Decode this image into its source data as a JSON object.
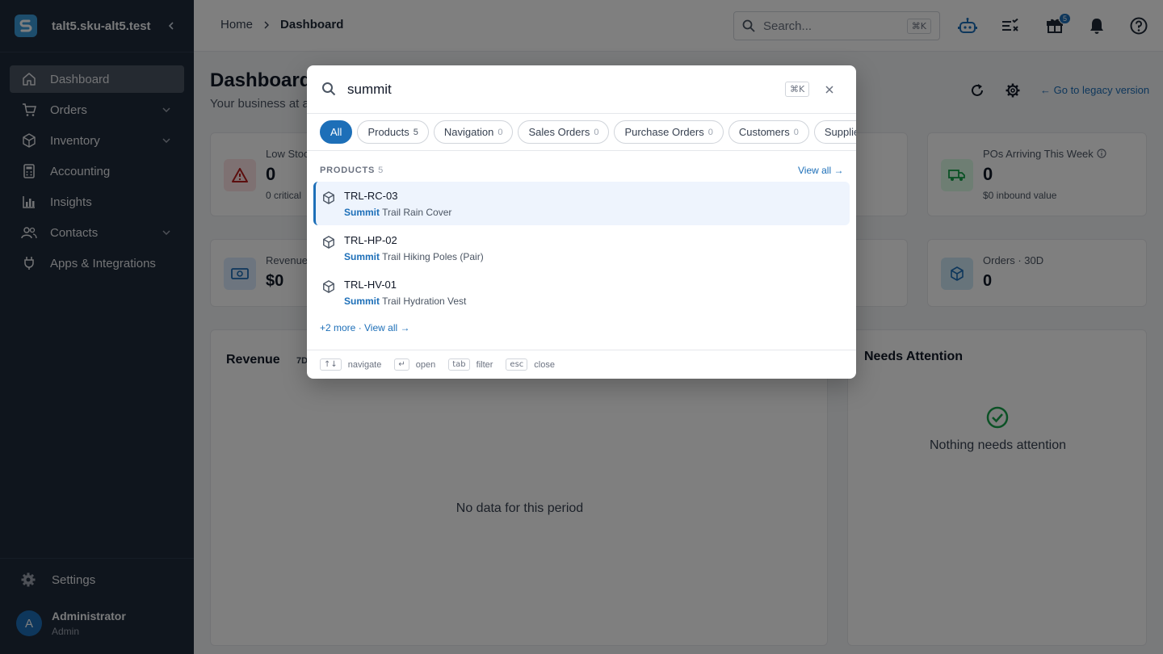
{
  "sidebar": {
    "org_name": "talt5.sku-alt5.test",
    "items": [
      {
        "label": "Dashboard",
        "icon": "home-icon",
        "active": true
      },
      {
        "label": "Orders",
        "icon": "cart-icon",
        "expandable": true
      },
      {
        "label": "Inventory",
        "icon": "box-icon",
        "expandable": true
      },
      {
        "label": "Accounting",
        "icon": "calculator-icon"
      },
      {
        "label": "Insights",
        "icon": "bar-chart-icon"
      },
      {
        "label": "Contacts",
        "icon": "people-icon",
        "expandable": true
      },
      {
        "label": "Apps & Integrations",
        "icon": "plug-icon"
      }
    ],
    "settings_label": "Settings",
    "user": {
      "initial": "A",
      "name": "Administrator",
      "role": "Admin"
    }
  },
  "header": {
    "breadcrumb": [
      "Home",
      "Dashboard"
    ],
    "search_placeholder": "Search...",
    "search_shortcut": "⌘K",
    "gift_badge": "5"
  },
  "dashboard": {
    "title": "Dashboard",
    "subtitle": "Your business at a",
    "legacy_link": "← Go to legacy version",
    "kpis": [
      {
        "label": "Low Stock",
        "value": "0",
        "sub": "0 critical"
      },
      {
        "label": "POs Arriving This Week",
        "value": "0",
        "sub": "$0 inbound value"
      },
      {
        "label": "Revenue",
        "value": "$0",
        "sub": ""
      },
      {
        "label": "Orders · 30D",
        "value": "0",
        "sub": ""
      }
    ],
    "revenue_title": "Revenue",
    "revenue_range": "7D",
    "revenue_empty": "No data for this period",
    "attention_title": "Needs Attention",
    "attention_empty": "Nothing needs attention"
  },
  "palette": {
    "query": "summit",
    "shortcut": "⌘K",
    "filters": [
      {
        "label": "All",
        "count": "",
        "active": true
      },
      {
        "label": "Products",
        "count": "5"
      },
      {
        "label": "Navigation",
        "count": "0"
      },
      {
        "label": "Sales Orders",
        "count": "0"
      },
      {
        "label": "Purchase Orders",
        "count": "0"
      },
      {
        "label": "Customers",
        "count": "0"
      },
      {
        "label": "Suppliers",
        "count": "0"
      }
    ],
    "group": {
      "label": "PRODUCTS",
      "count": "5",
      "view_all": "View all →"
    },
    "results": [
      {
        "sku": "TRL-RC-03",
        "highlight": "Summit",
        "rest": " Trail Rain Cover",
        "selected": true
      },
      {
        "sku": "TRL-HP-02",
        "highlight": "Summit",
        "rest": " Trail Hiking Poles (Pair)"
      },
      {
        "sku": "TRL-HV-01",
        "highlight": "Summit",
        "rest": " Trail Hydration Vest"
      }
    ],
    "more_link": "+2 more · View all →",
    "hints": [
      {
        "key": "↑↓",
        "label": "navigate"
      },
      {
        "key": "↵",
        "label": "open"
      },
      {
        "key": "tab",
        "label": "filter"
      },
      {
        "key": "esc",
        "label": "close"
      }
    ]
  },
  "colors": {
    "accent": "#1d6fb8",
    "sidebar": "#1e2a3b",
    "danger_bg": "#fde2e4",
    "success": "#16a34a"
  }
}
